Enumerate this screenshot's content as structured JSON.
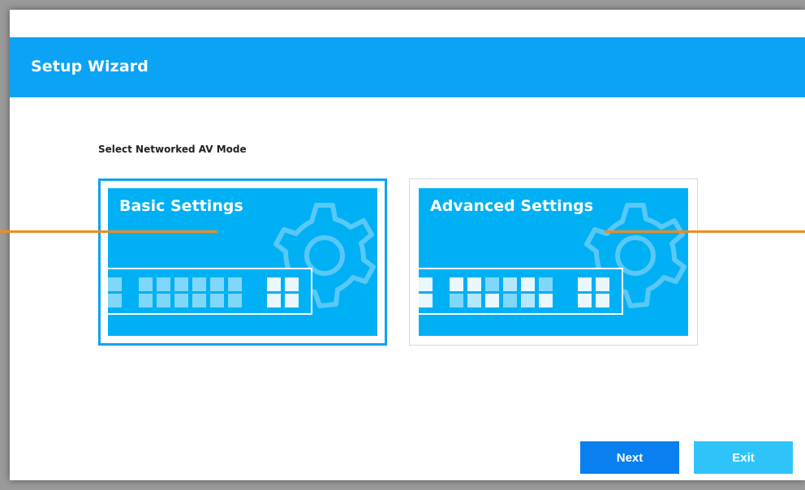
{
  "window": {
    "title": "Setup Wizard"
  },
  "prompt": "Select Networked AV Mode",
  "options": [
    {
      "label": "Basic Settings",
      "selected": true
    },
    {
      "label": "Advanced Settings",
      "selected": false
    }
  ],
  "buttons": {
    "next_label": "Next",
    "exit_label": "Exit"
  },
  "colors": {
    "header": "#0aa3f5",
    "card_panel": "#00b0f5",
    "next_button": "#0a7ff0",
    "exit_button": "#2ec4fa",
    "callout": "#f28a1c"
  }
}
